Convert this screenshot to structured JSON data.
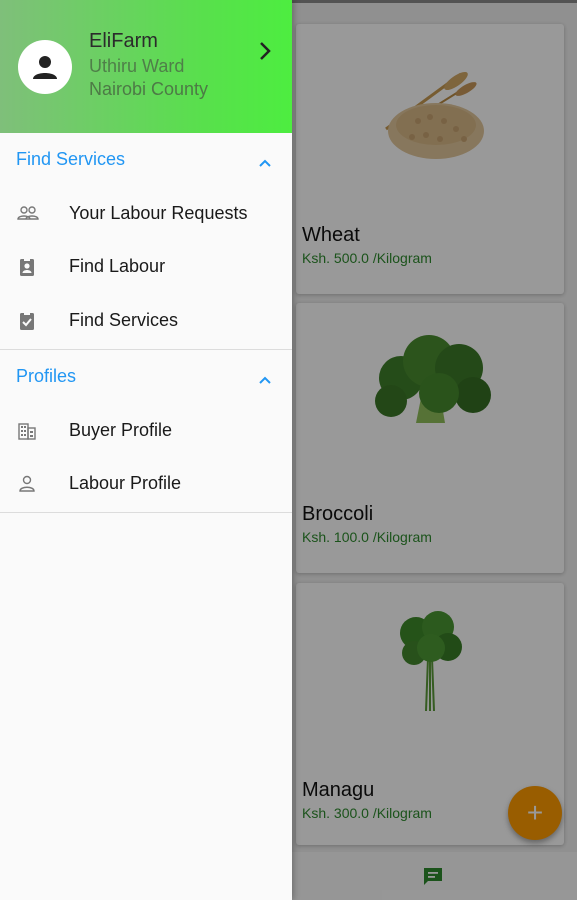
{
  "drawer": {
    "user": {
      "name": "EliFarm",
      "ward": "Uthiru Ward",
      "county": "Nairobi County"
    },
    "sections": [
      {
        "title": "Find Services",
        "items": [
          {
            "label": "Your Labour Requests",
            "icon": "people-outline-icon"
          },
          {
            "label": "Find Labour",
            "icon": "contact-badge-icon"
          },
          {
            "label": "Find Services",
            "icon": "clipboard-check-icon"
          }
        ]
      },
      {
        "title": "Profiles",
        "items": [
          {
            "label": "Buyer Profile",
            "icon": "building-icon"
          },
          {
            "label": "Labour Profile",
            "icon": "person-outline-icon"
          }
        ]
      }
    ]
  },
  "products": [
    {
      "name": "Wheat",
      "price": "Ksh. 500.0 /Kilogram",
      "image": "wheat-grain-image"
    },
    {
      "name": "Broccoli",
      "price": "Ksh. 100.0 /Kilogram",
      "image": "broccoli-image"
    },
    {
      "name": "Managu",
      "price": "Ksh. 300.0 /Kilogram",
      "image": "managu-greens-image"
    }
  ],
  "fab": {
    "symbol": "+"
  },
  "colors": {
    "header_green": "#58e04c",
    "section_blue": "#2196f3",
    "price_green": "#2e8b2e",
    "fab_orange": "#ff9b00",
    "chat_green": "#2e8b2e"
  }
}
